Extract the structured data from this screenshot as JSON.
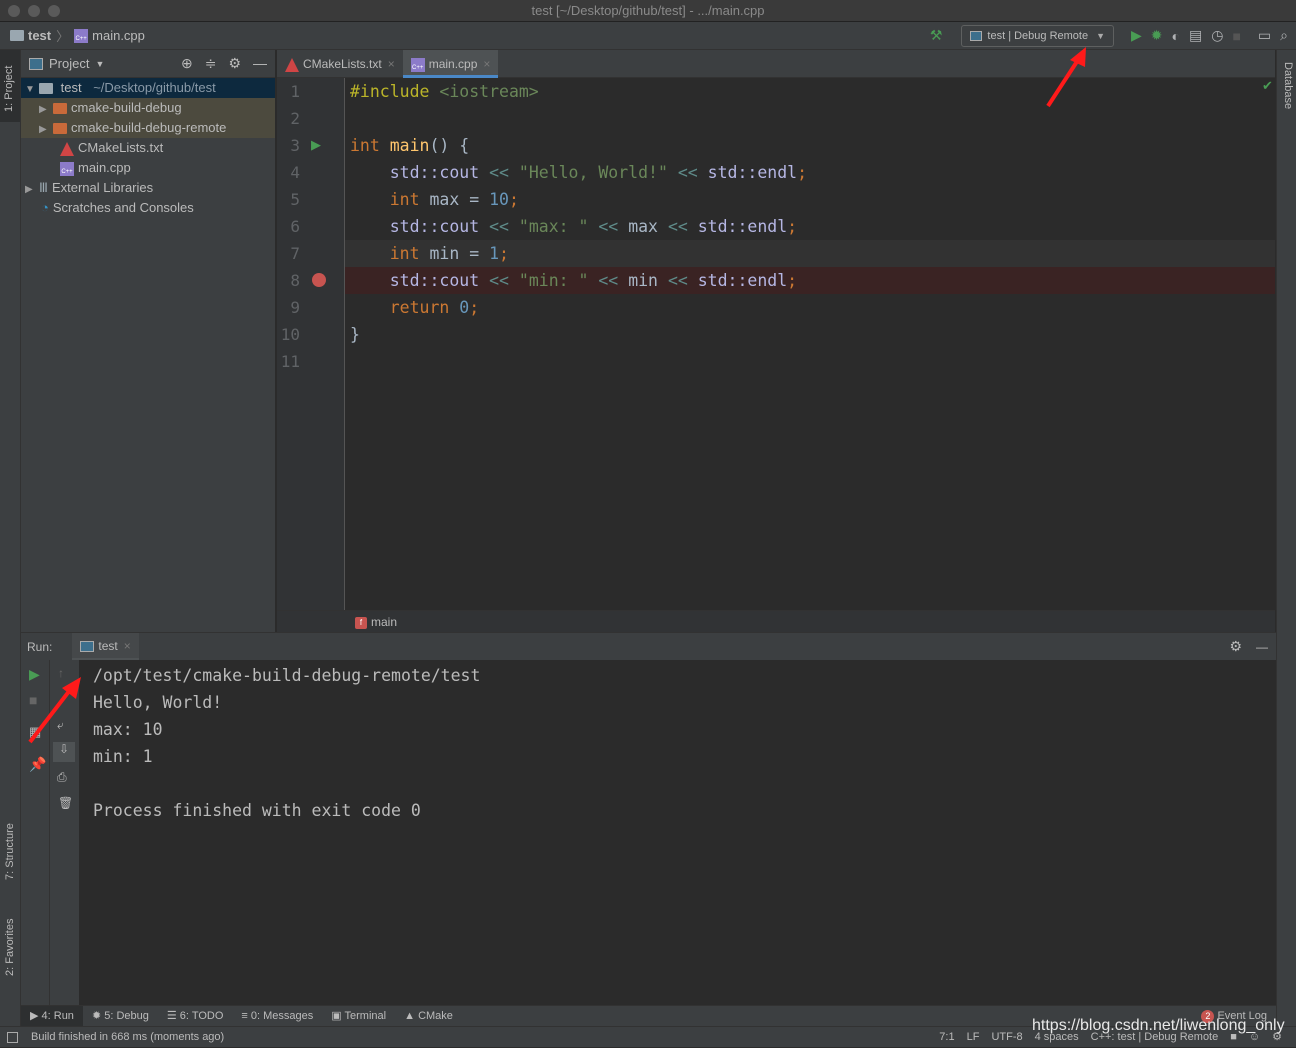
{
  "window_title": "test [~/Desktop/github/test] - .../main.cpp",
  "navbar": {
    "project": "test",
    "file": "main.cpp",
    "run_config": "test | Debug Remote"
  },
  "left_stripe": {
    "project": "1: Project",
    "structure": "7: Structure",
    "favorites": "2: Favorites"
  },
  "right_stripe": {
    "database": "Database"
  },
  "project_panel": {
    "title": "Project",
    "root": {
      "name": "test",
      "path": "~/Desktop/github/test"
    },
    "items": [
      {
        "label": "cmake-build-debug"
      },
      {
        "label": "cmake-build-debug-remote"
      },
      {
        "label": "CMakeLists.txt"
      },
      {
        "label": "main.cpp"
      },
      {
        "label": "External Libraries"
      },
      {
        "label": "Scratches and Consoles"
      }
    ]
  },
  "editor": {
    "tabs": [
      {
        "label": "CMakeLists.txt"
      },
      {
        "label": "main.cpp",
        "active": true
      }
    ],
    "line_numbers": [
      "1",
      "2",
      "3",
      "4",
      "5",
      "6",
      "7",
      "8",
      "9",
      "10",
      "11"
    ],
    "lines": [
      [
        {
          "t": "#include ",
          "c": "pp"
        },
        {
          "t": "<iostream>",
          "c": "hd"
        }
      ],
      [],
      [
        {
          "t": "int ",
          "c": "kw"
        },
        {
          "t": "main",
          "c": "fn"
        },
        {
          "t": "() {",
          "c": "tx"
        }
      ],
      [
        {
          "t": "    std::cout ",
          "c": "ns"
        },
        {
          "t": "<< ",
          "c": "op"
        },
        {
          "t": "\"Hello, World!\" ",
          "c": "str"
        },
        {
          "t": "<< ",
          "c": "op"
        },
        {
          "t": "std::endl",
          "c": "ns"
        },
        {
          "t": ";",
          "c": "kw"
        }
      ],
      [
        {
          "t": "    int ",
          "c": "kw"
        },
        {
          "t": "max = ",
          "c": "tx"
        },
        {
          "t": "10",
          "c": "num"
        },
        {
          "t": ";",
          "c": "kw"
        }
      ],
      [
        {
          "t": "    std::cout ",
          "c": "ns"
        },
        {
          "t": "<< ",
          "c": "op"
        },
        {
          "t": "\"max: \" ",
          "c": "str"
        },
        {
          "t": "<< ",
          "c": "op"
        },
        {
          "t": "max ",
          "c": "tx"
        },
        {
          "t": "<< ",
          "c": "op"
        },
        {
          "t": "std::endl",
          "c": "ns"
        },
        {
          "t": ";",
          "c": "kw"
        }
      ],
      [
        {
          "t": "    int ",
          "c": "kw"
        },
        {
          "t": "min = ",
          "c": "tx"
        },
        {
          "t": "1",
          "c": "num"
        },
        {
          "t": ";",
          "c": "kw"
        }
      ],
      [
        {
          "t": "    std::cout ",
          "c": "ns"
        },
        {
          "t": "<< ",
          "c": "op"
        },
        {
          "t": "\"min: \" ",
          "c": "str"
        },
        {
          "t": "<< ",
          "c": "op"
        },
        {
          "t": "min ",
          "c": "tx"
        },
        {
          "t": "<< ",
          "c": "op"
        },
        {
          "t": "std::endl",
          "c": "ns"
        },
        {
          "t": ";",
          "c": "kw"
        }
      ],
      [
        {
          "t": "    return ",
          "c": "kw"
        },
        {
          "t": "0",
          "c": "num"
        },
        {
          "t": ";",
          "c": "kw"
        }
      ],
      [
        {
          "t": "}",
          "c": "tx"
        }
      ],
      []
    ],
    "caret_line": 7,
    "breakpoint_line": 8,
    "breadcrumb": "main"
  },
  "run_panel": {
    "label": "Run:",
    "tab": "test",
    "output": [
      "/opt/test/cmake-build-debug-remote/test",
      "Hello, World!",
      "max: 10",
      "min: 1",
      "",
      "Process finished with exit code 0"
    ]
  },
  "tool_windows": [
    {
      "label": "4: Run",
      "active": true
    },
    {
      "label": "5: Debug"
    },
    {
      "label": "6: TODO"
    },
    {
      "label": "0: Messages"
    },
    {
      "label": "Terminal"
    },
    {
      "label": "CMake"
    }
  ],
  "event_log": {
    "count": "2",
    "label": "Event Log"
  },
  "status": {
    "message": "Build finished in 668 ms (moments ago)",
    "position": "7:1",
    "line_sep": "LF",
    "encoding": "UTF-8",
    "indent": "4 spaces",
    "context": "C++: test | Debug Remote"
  },
  "watermark": "https://blog.csdn.net/liwenlong_only",
  "colors": {
    "accent": "#4a88c7",
    "run_green": "#499c54",
    "breakpoint": "#c75450",
    "annotation_arrow": "#ff1a1a"
  }
}
